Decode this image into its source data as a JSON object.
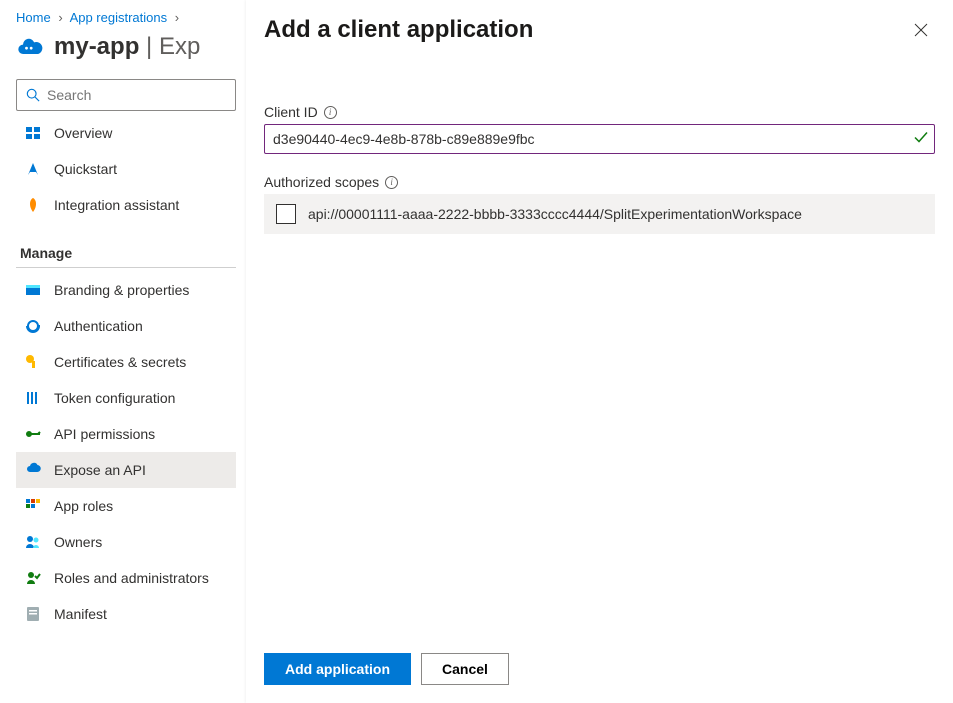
{
  "breadcrumb": {
    "home": "Home",
    "app_registrations": "App registrations"
  },
  "page": {
    "app_name": "my-app",
    "section": "Exp"
  },
  "search": {
    "placeholder": "Search"
  },
  "nav": {
    "items": [
      {
        "label": "Overview"
      },
      {
        "label": "Quickstart"
      },
      {
        "label": "Integration assistant"
      }
    ],
    "section_header": "Manage",
    "manage": [
      {
        "label": "Branding & properties"
      },
      {
        "label": "Authentication"
      },
      {
        "label": "Certificates & secrets"
      },
      {
        "label": "Token configuration"
      },
      {
        "label": "API permissions"
      },
      {
        "label": "Expose an API"
      },
      {
        "label": "App roles"
      },
      {
        "label": "Owners"
      },
      {
        "label": "Roles and administrators"
      },
      {
        "label": "Manifest"
      }
    ]
  },
  "panel": {
    "title": "Add a client application",
    "client_id_label": "Client ID",
    "client_id_value": "d3e90440-4ec9-4e8b-878b-c89e889e9fbc",
    "scopes_label": "Authorized scopes",
    "scope_value": "api://00001111-aaaa-2222-bbbb-3333cccc4444/SplitExperimentationWorkspace",
    "add_button": "Add application",
    "cancel_button": "Cancel"
  }
}
